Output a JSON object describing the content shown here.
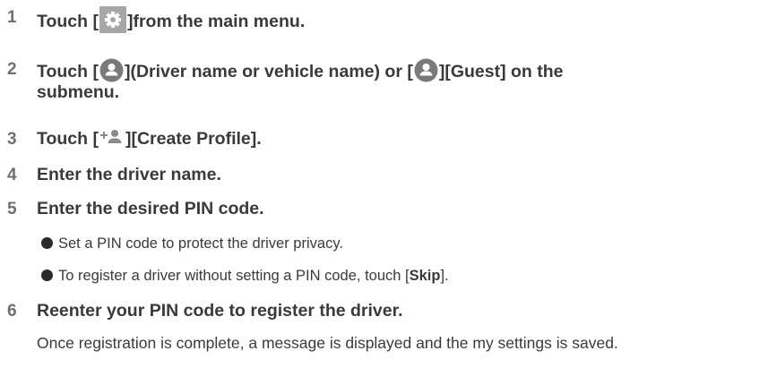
{
  "steps": [
    {
      "num": "1",
      "pre": "Touch [",
      "post": "]from the main menu."
    },
    {
      "num": "2",
      "pre": "Touch [",
      "mid": "](Driver name or vehicle name) or [",
      "post": "][Guest] on the",
      "line2": "submenu."
    },
    {
      "num": "3",
      "pre": "Touch [",
      "post": "][Create Profile]."
    },
    {
      "num": "4",
      "text": "Enter the driver name."
    },
    {
      "num": "5",
      "text": "Enter the desired PIN code."
    },
    {
      "num": "6",
      "text": "Reenter your PIN code to register the driver."
    }
  ],
  "bullets": {
    "b1": "Set a PIN code to protect the driver privacy.",
    "b2_pre": "To register a driver without setting a PIN code, touch [",
    "b2_bold": "Skip",
    "b2_post": "]."
  },
  "note": "Once registration is complete, a message is displayed and the my settings is saved.",
  "icons": {
    "step1": "gear-icon",
    "step2": "person-icon",
    "step3": "add-person-icon"
  },
  "colors": {
    "text": "#3a3a3a",
    "number": "#6e6e6e",
    "icon_gray": "#a7a7a7",
    "icon_dark": "#7a7a7a"
  }
}
